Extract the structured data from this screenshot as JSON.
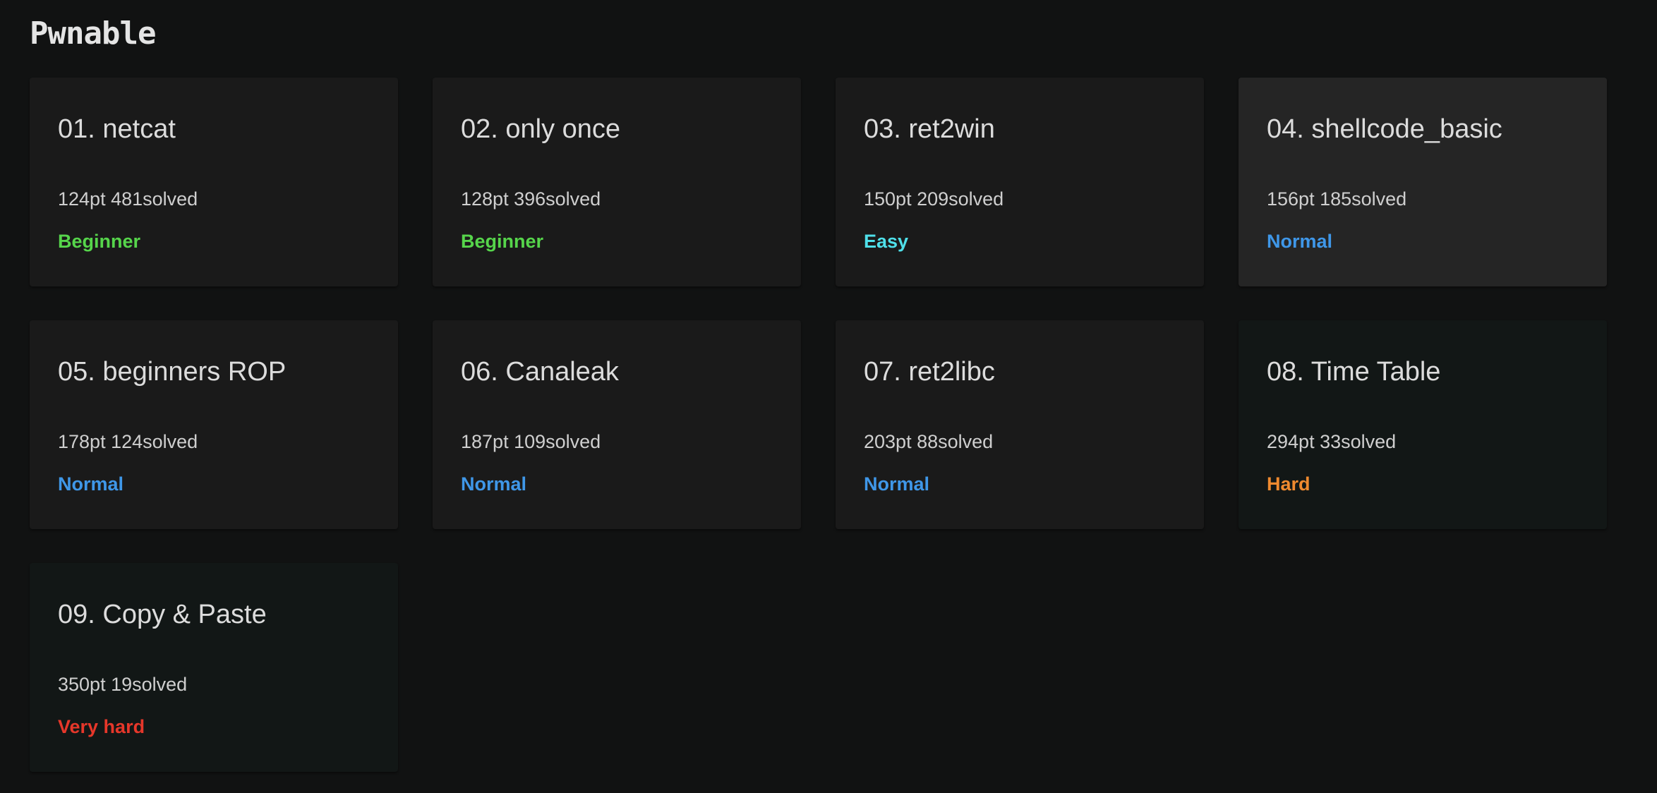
{
  "page": {
    "section_title": "Pwnable"
  },
  "colors": {
    "background": "#111212",
    "card": "#1a1a1a",
    "card_hover": "#252525",
    "card_solved": "#121716",
    "beginner": "#56d54b",
    "easy": "#4fe0ea",
    "normal": "#3f97e8",
    "hard": "#ef8a2f",
    "very_hard": "#e6372a"
  },
  "challenges": [
    {
      "title": "01. netcat",
      "points": "124pt",
      "solved": "481solved",
      "meta": "124pt 481solved",
      "level": "Beginner"
    },
    {
      "title": "02. only once",
      "points": "128pt",
      "solved": "396solved",
      "meta": "128pt 396solved",
      "level": "Beginner"
    },
    {
      "title": "03. ret2win",
      "points": "150pt",
      "solved": "209solved",
      "meta": "150pt 209solved",
      "level": "Easy"
    },
    {
      "title": "04. shellcode_basic",
      "points": "156pt",
      "solved": "185solved",
      "meta": "156pt 185solved",
      "level": "Normal"
    },
    {
      "title": "05. beginners ROP",
      "points": "178pt",
      "solved": "124solved",
      "meta": "178pt 124solved",
      "level": "Normal"
    },
    {
      "title": "06. Canaleak",
      "points": "187pt",
      "solved": "109solved",
      "meta": "187pt 109solved",
      "level": "Normal"
    },
    {
      "title": "07. ret2libc",
      "points": "203pt",
      "solved": "88solved",
      "meta": "203pt 88solved",
      "level": "Normal"
    },
    {
      "title": "08. Time Table",
      "points": "294pt",
      "solved": "33solved",
      "meta": "294pt 33solved",
      "level": "Hard"
    },
    {
      "title": "09. Copy & Paste",
      "points": "350pt",
      "solved": "19solved",
      "meta": "350pt 19solved",
      "level": "Very hard"
    }
  ]
}
